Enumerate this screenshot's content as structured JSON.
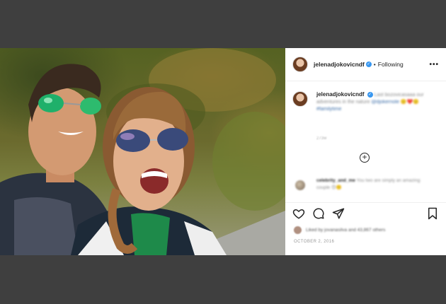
{
  "post": {
    "username": "jelenadjokovicndf",
    "verified_glyph": "✓",
    "dot": "•",
    "follow_label": "Following",
    "more_label": "•••",
    "caption_user": "jelenadjokovicndf",
    "caption_text": "Last bozovicasaaa our adventures in the nature",
    "caption_mention": "@djokernole",
    "caption_emoji": "🙂❤️🙂",
    "caption_hashtag": "#familytime",
    "caption_time": "273w",
    "load_more_glyph": "+",
    "comment_user": "celebrity_and_me",
    "comment_text": "You two are simply an amazing couple 😍🙂",
    "likes_text": "Liked by jovanasilva and 43,867 others",
    "date": "OCTOBER 2, 2016"
  },
  "icons": {
    "heart": "heart-icon",
    "comment": "comment-icon",
    "share": "share-icon",
    "bookmark": "bookmark-icon"
  },
  "colors": {
    "background": "#3f3f3f",
    "panel": "#ffffff",
    "verified": "#3897f0",
    "text": "#262626",
    "muted": "#9a9a9a"
  }
}
